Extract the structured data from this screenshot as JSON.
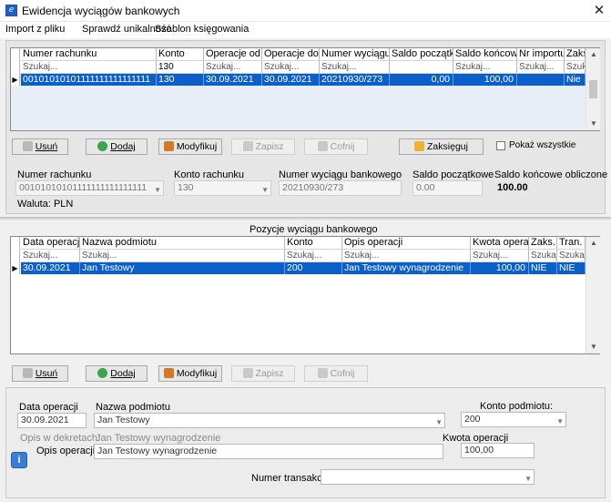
{
  "window": {
    "title": "Ewidencja wyciągów bankowych",
    "close_glyph": "✕"
  },
  "menu": [
    "Import z pliku",
    "Sprawdź unikalność",
    "Szablon księgowania"
  ],
  "top_grid": {
    "headers": [
      "Numer rachunku",
      "Konto",
      "Operacje od",
      "Operacje do",
      "Numer wyciągu",
      "Saldo początk.",
      "Saldo końcowe",
      "Nr importu",
      "Zaks."
    ],
    "search": [
      "Szukaj...",
      "130",
      "Szukaj...",
      "Szukaj...",
      "Szukaj...",
      "",
      "Szukaj...",
      "Szukaj...",
      "Szuka"
    ],
    "row": [
      "00101010101111111111111111",
      "130",
      "30.09.2021",
      "30.09.2021",
      "20210930/273",
      "0,00",
      "100,00",
      "",
      "Nie"
    ]
  },
  "top_buttons": {
    "delete": "Usuń",
    "add": "Dodaj",
    "modify": "Modyfikuj",
    "save": "Zapisz",
    "undo": "Cofnij",
    "post": "Zaksięguj",
    "show_all": "Pokaż wszystkie"
  },
  "top_form": {
    "account_label": "Numer rachunku",
    "account_value": "00101010101111111111111111",
    "konto_label": "Konto rachunku",
    "konto_value": "130",
    "statement_label": "Numer wyciągu bankowego",
    "statement_value": "20210930/273",
    "opening_label": "Saldo początkowe",
    "opening_value": "0.00",
    "closing_label": "Saldo końcowe obliczone",
    "closing_value": "100.00",
    "currency": "Waluta: PLN"
  },
  "positions": {
    "title": "Pozycje wyciągu bankowego",
    "headers": [
      "Data operacji",
      "Nazwa podmiotu",
      "Konto",
      "Opis operacji",
      "Kwota operacji",
      "Zaks.",
      "Tran."
    ],
    "search": [
      "Szukaj...",
      "Szukaj...",
      "Szukaj...",
      "Szukaj...",
      "Szukaj...",
      "Szukaj",
      "Szukaj"
    ],
    "row": [
      "30.09.2021",
      "Jan Testowy",
      "200",
      "Jan Testowy wynagrodzenie",
      "100,00",
      "NIE",
      "NIE"
    ]
  },
  "bottom_buttons": {
    "delete": "Usuń",
    "add": "Dodaj",
    "modify": "Modyfikuj",
    "save": "Zapisz",
    "undo": "Cofnij"
  },
  "bottom_form": {
    "date_label": "Data operacji",
    "date_value": "30.09.2021",
    "entity_label": "Nazwa podmiotu",
    "entity_value": "Jan Testowy",
    "konto_label": "Konto podmiotu:",
    "konto_value": "200",
    "decree_label": "Opis w dekretach:",
    "decree_value": "Jan Testowy wynagrodzenie",
    "desc_label": "Opis operacji:",
    "desc_value": "Jan Testowy wynagrodzenie",
    "amount_label": "Kwota operacji",
    "amount_value": "100,00",
    "transaction_label": "Numer transakcji:",
    "transaction_value": ""
  },
  "colors": {
    "selection": "#0b5fc9",
    "panel": "#ececec",
    "window": "#f0f0f0"
  }
}
